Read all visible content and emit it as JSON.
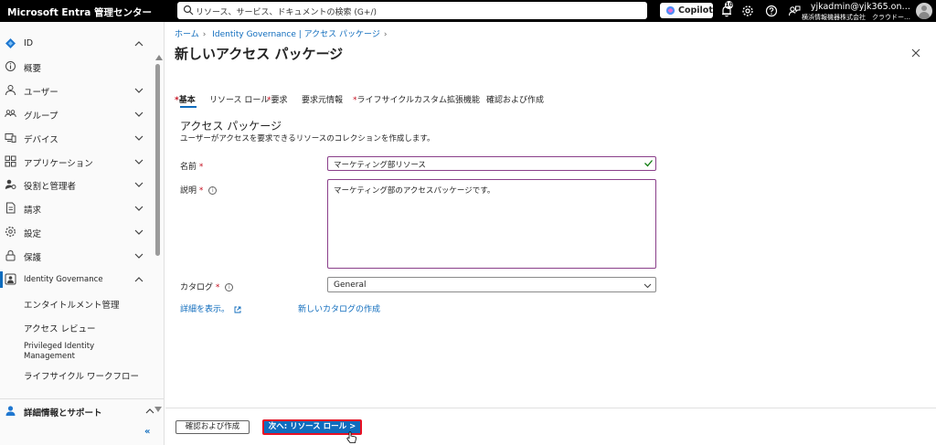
{
  "topbar": {
    "brand": "Microsoft Entra 管理センター",
    "search_placeholder": "リソース、サービス、ドキュメントの検索 (G+/)",
    "copilot_label": "Copilot",
    "notification_count": "10",
    "user_name": "yjkadmin@yjk365.on…",
    "user_tenant": "横浜情報機器株式会社　クラウドー…"
  },
  "sidebar": {
    "items": [
      {
        "label": "ID",
        "icon": "diamond-icon"
      },
      {
        "label": "概要",
        "icon": "info-icon"
      },
      {
        "label": "ユーザー",
        "icon": "person-icon"
      },
      {
        "label": "グループ",
        "icon": "group-icon"
      },
      {
        "label": "デバイス",
        "icon": "devices-icon"
      },
      {
        "label": "アプリケーション",
        "icon": "apps-icon"
      },
      {
        "label": "役割と管理者",
        "icon": "roles-icon"
      },
      {
        "label": "請求",
        "icon": "billing-icon"
      },
      {
        "label": "設定",
        "icon": "gear-icon"
      },
      {
        "label": "保護",
        "icon": "lock-icon"
      },
      {
        "label": "Identity Governance",
        "icon": "governance-icon"
      }
    ],
    "sub_items": [
      "エンタイトルメント管理",
      "アクセス レビュー",
      "Privileged Identity Management",
      "ライフサイクル ワークフロー"
    ],
    "help_label": "詳細情報とサポート",
    "collapse_label": "«"
  },
  "breadcrumb": {
    "home": "ホーム",
    "section": "Identity Governance | アクセス パッケージ"
  },
  "page": {
    "title": "新しいアクセス パッケージ",
    "more": "···"
  },
  "tabs": [
    {
      "label": "基本",
      "required": true
    },
    {
      "label": "リソース ロール",
      "required": false
    },
    {
      "label": "要求",
      "required": true
    },
    {
      "label": "要求元情報",
      "required": false
    },
    {
      "label": "ライフサイクル",
      "required": true
    },
    {
      "label": "カスタム拡張機能",
      "required": false
    },
    {
      "label": "確認および作成",
      "required": false
    }
  ],
  "section": {
    "title": "アクセス パッケージ",
    "description": "ユーザーがアクセスを要求できるリソースのコレクションを作成します。"
  },
  "form": {
    "name_label": "名前",
    "name_value": "マーケティング部リソース",
    "description_label": "説明",
    "description_value": "マーケティング部のアクセスパッケージです。",
    "catalog_label": "カタログ",
    "catalog_value": "General",
    "required_mark": "*",
    "info_glyph": "i"
  },
  "links": {
    "details": "詳細を表示。",
    "new_catalog": "新しいカタログの作成"
  },
  "footer": {
    "review_button": "確認および作成",
    "next_button": "次へ: リソース ロール >"
  },
  "colors": {
    "accent": "#0f6cbd",
    "required": "#c50f1f",
    "highlight_border": "#e81123",
    "field_border_active": "#8a3f8a"
  }
}
